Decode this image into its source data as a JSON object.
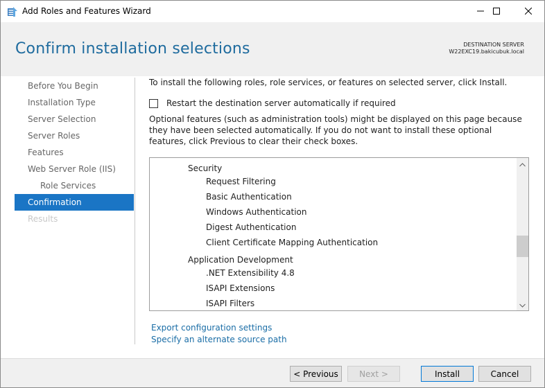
{
  "window": {
    "title": "Add Roles and Features Wizard",
    "icons": {
      "app": "server-manager-icon",
      "minimize": "minimize-icon",
      "maximize": "maximize-icon",
      "close": "close-icon"
    }
  },
  "header": {
    "page_title": "Confirm installation selections",
    "destination_label": "DESTINATION SERVER",
    "destination_server": "W22EXC19.bakicubuk.local"
  },
  "sidebar": {
    "items": [
      {
        "label": "Before You Begin",
        "state": "normal"
      },
      {
        "label": "Installation Type",
        "state": "normal"
      },
      {
        "label": "Server Selection",
        "state": "normal"
      },
      {
        "label": "Server Roles",
        "state": "normal"
      },
      {
        "label": "Features",
        "state": "normal"
      },
      {
        "label": "Web Server Role (IIS)",
        "state": "normal"
      },
      {
        "label": "Role Services",
        "state": "normal"
      },
      {
        "label": "Confirmation",
        "state": "active"
      },
      {
        "label": "Results",
        "state": "disabled"
      }
    ]
  },
  "content": {
    "intro": "To install the following roles, role services, or features on selected server, click Install.",
    "restart_checkbox": {
      "label": "Restart the destination server automatically if required",
      "checked": false
    },
    "optional_note": "Optional features (such as administration tools) might be displayed on this page because they have been selected automatically. If you do not want to install these optional features, click Previous to clear their check boxes.",
    "list_items": [
      {
        "text": "Security",
        "level": 1
      },
      {
        "text": "Request Filtering",
        "level": 2
      },
      {
        "text": "Basic Authentication",
        "level": 2
      },
      {
        "text": "Windows Authentication",
        "level": 2
      },
      {
        "text": "Digest Authentication",
        "level": 2
      },
      {
        "text": "Client Certificate Mapping Authentication",
        "level": 2
      },
      {
        "text": "Application Development",
        "level": 1
      },
      {
        "text": ".NET Extensibility 4.8",
        "level": 2
      },
      {
        "text": "ISAPI Extensions",
        "level": 2
      },
      {
        "text": "ISAPI Filters",
        "level": 2
      }
    ],
    "links": {
      "export": "Export configuration settings",
      "alternate_source": "Specify an alternate source path"
    }
  },
  "footer": {
    "previous": "< Previous",
    "next": "Next >",
    "install": "Install",
    "cancel": "Cancel"
  },
  "colors": {
    "accent": "#1a75c5",
    "title": "#1e6b9e",
    "link": "#1a6da6"
  }
}
